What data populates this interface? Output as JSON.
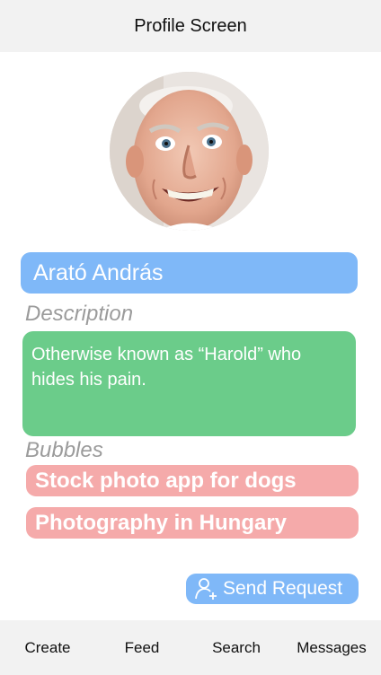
{
  "header": {
    "title": "Profile Screen"
  },
  "profile": {
    "avatar_alt": "profile photo",
    "name": "Arató András",
    "description_label": "Description",
    "description": "Otherwise known as “Harold” who hides his pain.",
    "bubbles_label": "Bubbles",
    "bubbles": [
      {
        "label": "Stock photo app for dogs"
      },
      {
        "label": "Photography in Hungary"
      }
    ]
  },
  "actions": {
    "send_request_label": "Send Request",
    "send_request_icon": "add-user-icon"
  },
  "tabbar": {
    "tabs": [
      {
        "label": "Create"
      },
      {
        "label": "Feed"
      },
      {
        "label": "Search"
      },
      {
        "label": "Messages"
      }
    ]
  },
  "colors": {
    "header_bg": "#f2f2f2",
    "name_field": "#7fb8f8",
    "description_box": "#6bcc8a",
    "bubble": "#f5aaaa",
    "send_button": "#7fb8f8"
  }
}
